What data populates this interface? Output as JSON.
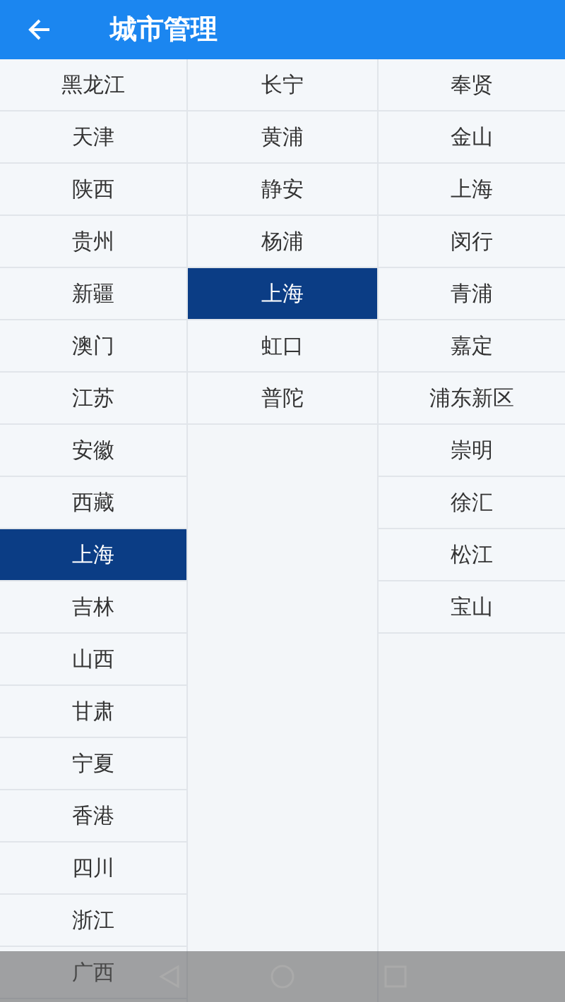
{
  "header": {
    "title": "城市管理"
  },
  "provinces": [
    {
      "label": "黑龙江",
      "selected": false
    },
    {
      "label": "天津",
      "selected": false
    },
    {
      "label": "陕西",
      "selected": false
    },
    {
      "label": "贵州",
      "selected": false
    },
    {
      "label": "新疆",
      "selected": false
    },
    {
      "label": "澳门",
      "selected": false
    },
    {
      "label": "江苏",
      "selected": false
    },
    {
      "label": "安徽",
      "selected": false
    },
    {
      "label": "西藏",
      "selected": false
    },
    {
      "label": "上海",
      "selected": true
    },
    {
      "label": "吉林",
      "selected": false
    },
    {
      "label": "山西",
      "selected": false
    },
    {
      "label": "甘肃",
      "selected": false
    },
    {
      "label": "宁夏",
      "selected": false
    },
    {
      "label": "香港",
      "selected": false
    },
    {
      "label": "四川",
      "selected": false
    },
    {
      "label": "浙江",
      "selected": false
    },
    {
      "label": "广西",
      "selected": false
    }
  ],
  "cities": [
    {
      "label": "长宁",
      "selected": false
    },
    {
      "label": "黄浦",
      "selected": false
    },
    {
      "label": "静安",
      "selected": false
    },
    {
      "label": "杨浦",
      "selected": false
    },
    {
      "label": "上海",
      "selected": true
    },
    {
      "label": "虹口",
      "selected": false
    },
    {
      "label": "普陀",
      "selected": false
    }
  ],
  "districts": [
    {
      "label": "奉贤",
      "selected": false
    },
    {
      "label": "金山",
      "selected": false
    },
    {
      "label": "上海",
      "selected": false
    },
    {
      "label": "闵行",
      "selected": false
    },
    {
      "label": "青浦",
      "selected": false
    },
    {
      "label": "嘉定",
      "selected": false
    },
    {
      "label": "浦东新区",
      "selected": false
    },
    {
      "label": "崇明",
      "selected": false
    },
    {
      "label": "徐汇",
      "selected": false
    },
    {
      "label": "松江",
      "selected": false
    },
    {
      "label": "宝山",
      "selected": false
    }
  ]
}
